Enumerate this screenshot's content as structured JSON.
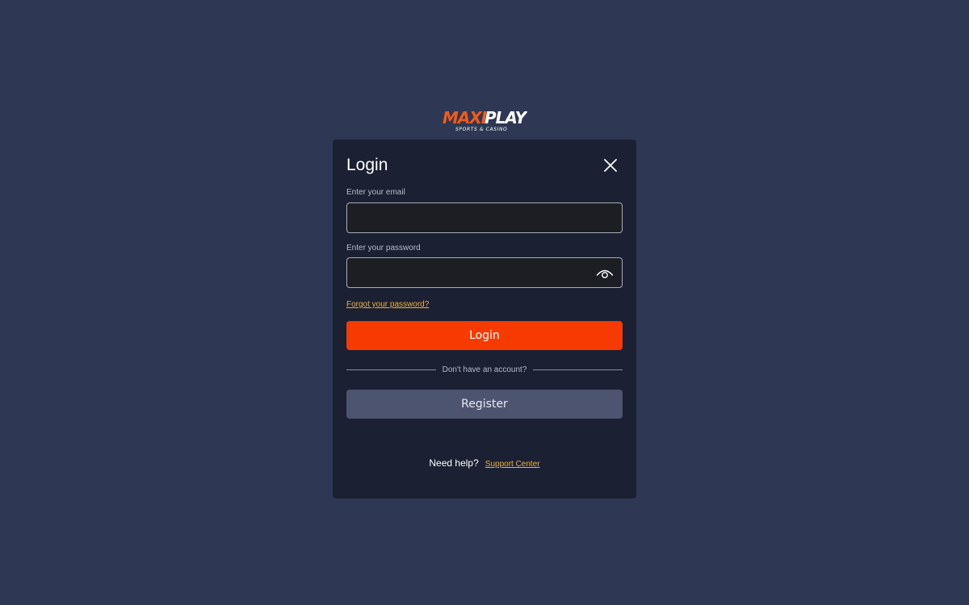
{
  "brand": {
    "name_part1": "MAXI",
    "name_part2": "PLAY",
    "tagline": "SPORTS & CASINO",
    "color_primary": "#f25a1b",
    "color_secondary": "#ffffff"
  },
  "modal": {
    "title": "Login",
    "close_icon": "close-icon"
  },
  "email": {
    "label": "Enter your email",
    "value": "",
    "placeholder": ""
  },
  "password": {
    "label": "Enter your password",
    "value": "",
    "placeholder": "",
    "toggle_icon": "eye-icon"
  },
  "links": {
    "forgot_password": "Forgot your password?",
    "support_center": "Support Center"
  },
  "buttons": {
    "login": "Login",
    "register": "Register"
  },
  "divider_text": "Don't have an account?",
  "help_text": "Need help?",
  "colors": {
    "background": "#2e3854",
    "modal": "#1b2033",
    "accent": "#f73b00",
    "link": "#f2b233",
    "secondary_button": "#4c5470"
  }
}
